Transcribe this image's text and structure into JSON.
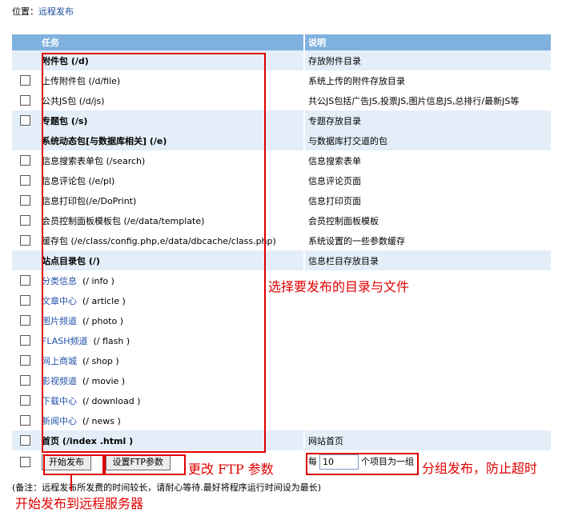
{
  "breadcrumb": {
    "label": "位置：",
    "link": "远程发布"
  },
  "table": {
    "headers": {
      "task": "任务",
      "desc": "说明"
    },
    "rows": [
      {
        "task": "附件包 (/d)",
        "desc": "存放附件目录"
      },
      {
        "task": "上传附件包 (/d/file)",
        "desc": "系统上传的附件存放目录"
      },
      {
        "task": "公共JS包 (/d/js)",
        "desc": "共公JS包括广告JS,投票JS,图片信息JS,总排行/最新JS等"
      },
      {
        "task": "专题包 (/s)",
        "desc": "专题存放目录"
      },
      {
        "task": "系统动态包[与数据库相关] (/e)",
        "desc": "与数据库打交道的包"
      },
      {
        "task": "信息搜索表单包 (/search)",
        "desc": "信息搜索表单"
      },
      {
        "task": "信息评论包 (/e/pl)",
        "desc": "信息评论页面"
      },
      {
        "task": "信息打印包(/e/DoPrint)",
        "desc": "信息打印页面"
      },
      {
        "task": "会员控制面板模板包 (/e/data/template)",
        "desc": "会员控制面板模板"
      },
      {
        "task": "缓存包 (/e/class/config.php,e/data/dbcache/class.php)",
        "desc": "系统设置的一些参数缓存"
      },
      {
        "task": "站点目录包 (/)",
        "desc": "信息栏目存放目录"
      },
      {
        "link": "分类信息",
        "path": "(/ info )"
      },
      {
        "link": "文章中心",
        "path": "(/ article )"
      },
      {
        "link": "图片频道",
        "path": "(/ photo )"
      },
      {
        "link": "FLASH频道",
        "path": "(/ flash )"
      },
      {
        "link": "网上商城",
        "path": "(/ shop )"
      },
      {
        "link": "影视频道",
        "path": "(/ movie )"
      },
      {
        "link": "下载中心",
        "path": "(/ download )"
      },
      {
        "link": "新闻中心",
        "path": "(/ news )"
      },
      {
        "task": "首页 (/index .html )",
        "desc": "网站首页"
      }
    ]
  },
  "buttons": {
    "start": "开始发布",
    "ftp": "设置FTP参数"
  },
  "group": {
    "prefix": "每",
    "value": "10",
    "suffix": "个项目为一组"
  },
  "note": "(备注：远程发布所发费的时间较长，请耐心等待.最好将程序运行时间设为最长)",
  "annotations": {
    "select": "选择要发布的目录与文件",
    "ftp": "更改 FTP 参数",
    "group": "分组发布，防止超时",
    "start": "开始发布到远程服务器"
  },
  "colors": {
    "annotation": "#e00000",
    "header": "#7fb1de",
    "group_row": "#e4eef9",
    "link": "#2452a8"
  }
}
